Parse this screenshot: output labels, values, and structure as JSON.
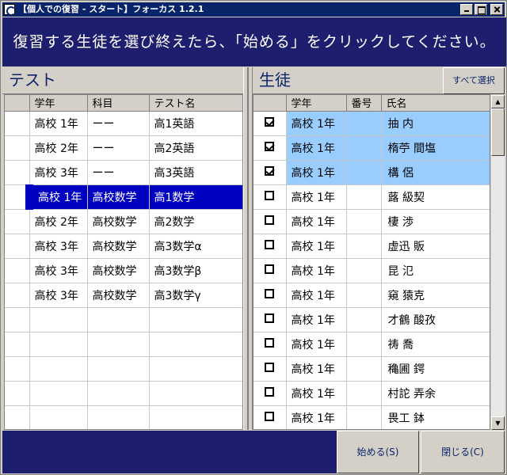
{
  "window": {
    "title": "【個人での復習 - スタート】フォーカス 1.2.1"
  },
  "banner": {
    "text": "復習する生徒を選び終えたら、「始める」をクリックしてください。"
  },
  "left_panel": {
    "title": "テスト",
    "columns": [
      "学年",
      "科目",
      "テスト名"
    ],
    "rows": [
      {
        "grade": "高校 1年",
        "subject": "ーー",
        "test": "高1英語",
        "selected": false
      },
      {
        "grade": "高校 2年",
        "subject": "ーー",
        "test": "高2英語",
        "selected": false
      },
      {
        "grade": "高校 3年",
        "subject": "ーー",
        "test": "高3英語",
        "selected": false
      },
      {
        "grade": "高校 1年",
        "subject": "高校数学",
        "test": "高1数学",
        "selected": true
      },
      {
        "grade": "高校 2年",
        "subject": "高校数学",
        "test": "高2数学",
        "selected": false
      },
      {
        "grade": "高校 3年",
        "subject": "高校数学",
        "test": "高3数学α",
        "selected": false
      },
      {
        "grade": "高校 3年",
        "subject": "高校数学",
        "test": "高3数学β",
        "selected": false
      },
      {
        "grade": "高校 3年",
        "subject": "高校数学",
        "test": "高3数学γ",
        "selected": false
      }
    ],
    "empty_rows": 6
  },
  "right_panel": {
    "title": "生徒",
    "select_all_label": "すべて選択",
    "columns": [
      "学年",
      "番号",
      "氏名"
    ],
    "rows": [
      {
        "grade": "高校 1年",
        "number": "",
        "name": "抽 内",
        "checked": true
      },
      {
        "grade": "高校 1年",
        "number": "",
        "name": "楕苧 間塩",
        "checked": true
      },
      {
        "grade": "高校 1年",
        "number": "",
        "name": "構 侶",
        "checked": true
      },
      {
        "grade": "高校 1年",
        "number": "",
        "name": "蕗 級契",
        "checked": false
      },
      {
        "grade": "高校 1年",
        "number": "",
        "name": "棲 渉",
        "checked": false
      },
      {
        "grade": "高校 1年",
        "number": "",
        "name": "虚迅 販",
        "checked": false
      },
      {
        "grade": "高校 1年",
        "number": "",
        "name": "昆 氾",
        "checked": false
      },
      {
        "grade": "高校 1年",
        "number": "",
        "name": "窺 猿克",
        "checked": false
      },
      {
        "grade": "高校 1年",
        "number": "",
        "name": "才鶴 酸孜",
        "checked": false
      },
      {
        "grade": "高校 1年",
        "number": "",
        "name": "祷 喬",
        "checked": false
      },
      {
        "grade": "高校 1年",
        "number": "",
        "name": "穐圃 鍔",
        "checked": false
      },
      {
        "grade": "高校 1年",
        "number": "",
        "name": "村詑 弄余",
        "checked": false
      },
      {
        "grade": "高校 1年",
        "number": "",
        "name": "畏工 鉢",
        "checked": false
      }
    ]
  },
  "footer": {
    "start_label": "始める(S)",
    "close_label": "閉じる(C)"
  },
  "colors": {
    "banner_bg": "#1e1e6e",
    "selected_row": "#0000c0",
    "checked_row": "#99ccff",
    "title_bar": "#0a246a"
  }
}
